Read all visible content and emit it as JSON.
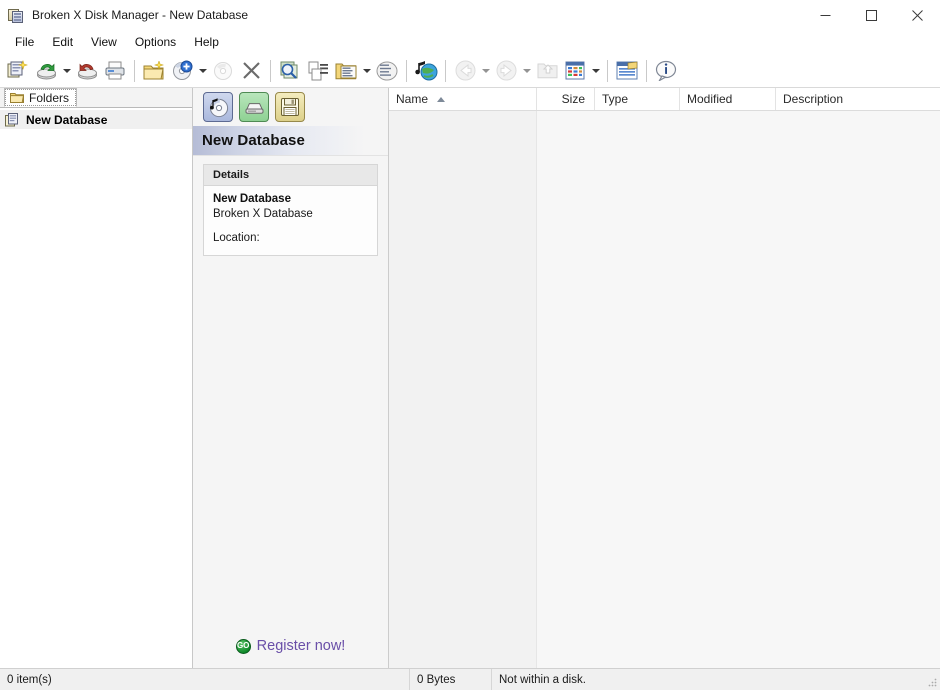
{
  "window": {
    "title": "Broken X Disk Manager - New Database",
    "icon": "app-window-icon",
    "controls": {
      "minimize": "minimize-icon",
      "maximize": "maximize-icon",
      "close": "close-icon"
    }
  },
  "menubar": {
    "items": [
      {
        "label": "File"
      },
      {
        "label": "Edit"
      },
      {
        "label": "View"
      },
      {
        "label": "Options"
      },
      {
        "label": "Help"
      }
    ]
  },
  "toolbar": {
    "buttons": [
      {
        "name": "new-database",
        "icon": "new-database-icon",
        "enabled": true,
        "dropdown": false
      },
      {
        "name": "open-database",
        "icon": "open-database-icon",
        "enabled": true,
        "dropdown": true
      },
      {
        "name": "save-database",
        "icon": "save-database-icon",
        "enabled": true,
        "dropdown": false
      },
      {
        "name": "print",
        "icon": "printer-icon",
        "enabled": true,
        "dropdown": false
      },
      {
        "name": "new-folder",
        "icon": "new-folder-icon",
        "enabled": true,
        "dropdown": false
      },
      {
        "name": "add-disk",
        "icon": "add-disk-icon",
        "enabled": true,
        "dropdown": true
      },
      {
        "name": "rescan-disk",
        "icon": "rescan-disk-icon",
        "enabled": false,
        "dropdown": false
      },
      {
        "name": "delete",
        "icon": "delete-x-icon",
        "enabled": true,
        "dropdown": false
      },
      {
        "name": "search",
        "icon": "search-disk-icon",
        "enabled": true,
        "dropdown": false
      },
      {
        "name": "properties",
        "icon": "properties-icon",
        "enabled": true,
        "dropdown": false
      },
      {
        "name": "list-folders",
        "icon": "list-folders-icon",
        "enabled": true,
        "dropdown": true
      },
      {
        "name": "list-items",
        "icon": "list-items-icon",
        "enabled": true,
        "dropdown": false
      },
      {
        "name": "web-media",
        "icon": "web-media-icon",
        "enabled": true,
        "dropdown": false
      },
      {
        "name": "back",
        "icon": "back-arrow-icon",
        "enabled": false,
        "dropdown": true
      },
      {
        "name": "forward",
        "icon": "forward-arrow-icon",
        "enabled": false,
        "dropdown": true
      },
      {
        "name": "up-one-level",
        "icon": "up-folder-icon",
        "enabled": false,
        "dropdown": false
      },
      {
        "name": "view-mode",
        "icon": "view-details-icon",
        "enabled": true,
        "dropdown": true
      },
      {
        "name": "report",
        "icon": "report-icon",
        "enabled": true,
        "dropdown": false
      },
      {
        "name": "about",
        "icon": "info-icon",
        "enabled": true,
        "dropdown": false
      }
    ]
  },
  "tree_pane": {
    "tab": {
      "label": "Folders",
      "icon": "folder-icon"
    },
    "nodes": [
      {
        "label": "New Database",
        "icon": "database-icon",
        "selected": true
      }
    ]
  },
  "details_pane": {
    "tabs": [
      {
        "name": "disc-tab",
        "icon": "cd-music-icon",
        "active": true
      },
      {
        "name": "drive-tab",
        "icon": "hard-drive-icon",
        "active": false
      },
      {
        "name": "floppy-tab",
        "icon": "floppy-disk-icon",
        "active": false
      }
    ],
    "header_title": "New Database",
    "card": {
      "title": "Details",
      "name": "New Database",
      "type": "Broken X Database",
      "location_label": "Location:",
      "location_value": ""
    },
    "register": {
      "icon": "go-icon",
      "icon_text": "GO",
      "label": "Register now!"
    }
  },
  "list_pane": {
    "columns": [
      {
        "label": "Name",
        "sorted": true,
        "sort_direction": "asc"
      },
      {
        "label": "Size",
        "sorted": false
      },
      {
        "label": "Type",
        "sorted": false
      },
      {
        "label": "Modified",
        "sorted": false
      },
      {
        "label": "Description",
        "sorted": false
      }
    ],
    "rows": []
  },
  "statusbar": {
    "items_text": "0 item(s)",
    "bytes_text": "0 Bytes",
    "disk_text": "Not within a disk."
  },
  "colors": {
    "accent_purple": "#6a4fa8",
    "header_gradient_start": "#b5bcd6",
    "go_green": "#0f8a2a",
    "window_bg": "#ffffff",
    "panel_bg": "#f5f5f5",
    "list_bg": "#f7f7f7"
  }
}
